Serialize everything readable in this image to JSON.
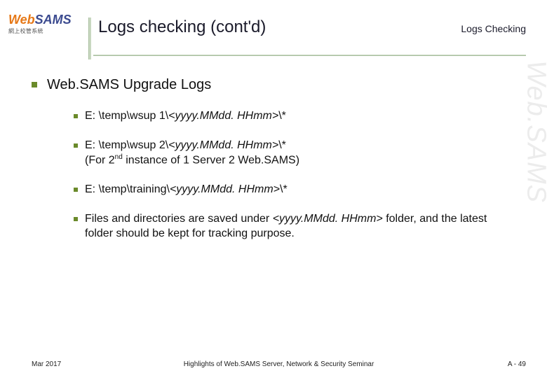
{
  "logo": {
    "web": "Web",
    "sams": "SAMS",
    "sub": "網上校管系統"
  },
  "title": "Logs checking (cont'd)",
  "subtitle": "Logs Checking",
  "heading": "Web.SAMS Upgrade Logs",
  "items": {
    "i1_a": "E: \\temp\\wsup 1\\",
    "i1_b": "<yyyy.MMdd. HHmm>",
    "i1_c": "\\*",
    "i2_a": "E: \\temp\\wsup 2\\",
    "i2_b": "<yyyy.MMdd. HHmm>",
    "i2_c": "\\*",
    "i2_note_a": " (For 2",
    "i2_note_sup": "nd",
    "i2_note_b": " instance of 1 Server 2 Web.SAMS)",
    "i3_a": "E: \\temp\\training\\",
    "i3_b": "<yyyy.MMdd. HHmm>",
    "i3_c": "\\*",
    "i4_a": "Files and directories are saved under ",
    "i4_b": "<yyyy.MMdd. HHmm>",
    "i4_c": " folder, and the latest folder should be kept for tracking purpose."
  },
  "footer": {
    "date": "Mar 2017",
    "center": "Highlights of Web.SAMS Server, Network & Security Seminar",
    "page": "A - 49"
  },
  "watermark": "Web.SAMS"
}
